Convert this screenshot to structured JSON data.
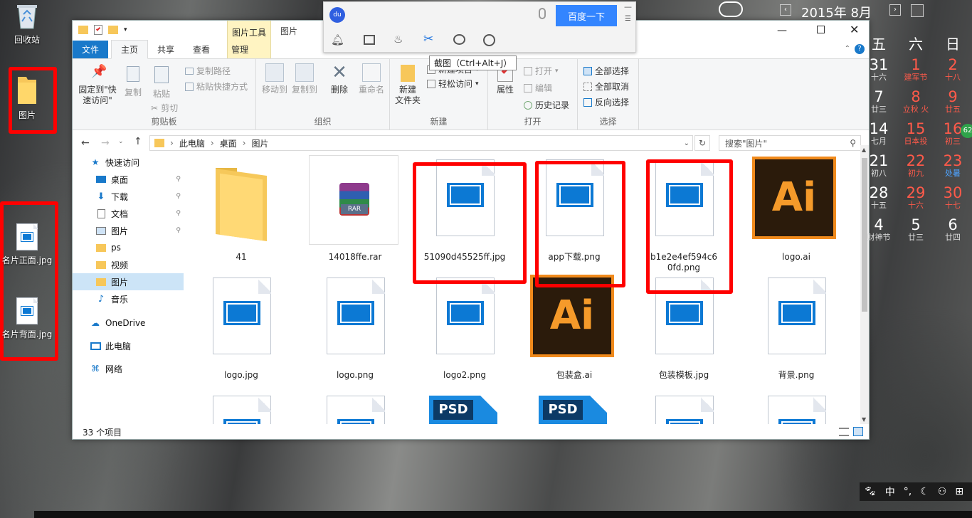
{
  "desktop": {
    "icons": [
      {
        "label": "回收站"
      },
      {
        "label": "图片"
      },
      {
        "label": "名片正面.jpg"
      },
      {
        "label": "名片背面.jpg"
      }
    ]
  },
  "baidu": {
    "search_value": "",
    "button_label": "百度一下",
    "tooltip": "截图（Ctrl+Alt+J）"
  },
  "explorer": {
    "title_context_tab": "图片工具",
    "title_name": "图片",
    "tabs": [
      "文件",
      "主页",
      "共享",
      "查看",
      "管理"
    ],
    "ribbon": {
      "clipboard": {
        "name": "剪贴板",
        "pin": "固定到\"快速访问\"",
        "copy": "复制",
        "paste": "粘贴",
        "copy_path": "复制路径",
        "paste_shortcut": "粘贴快捷方式",
        "cut": "剪切"
      },
      "organize": {
        "name": "组织",
        "move_to": "移动到",
        "copy_to": "复制到",
        "delete": "删除",
        "rename": "重命名"
      },
      "new": {
        "name": "新建",
        "new_folder": "新建\n文件夹",
        "new_item": "新建项目",
        "easy_access": "轻松访问"
      },
      "open": {
        "name": "打开",
        "properties": "属性",
        "open": "打开",
        "edit": "编辑",
        "history": "历史记录"
      },
      "select": {
        "name": "选择",
        "select_all": "全部选择",
        "select_none": "全部取消",
        "invert": "反向选择"
      }
    },
    "address": {
      "crumbs": [
        "此电脑",
        "桌面",
        "图片"
      ],
      "search_placeholder": "搜索\"图片\""
    },
    "nav": [
      {
        "label": "快速访问",
        "icon": "star-icon"
      },
      {
        "label": "桌面",
        "icon": "desktop-icon",
        "pinned": true
      },
      {
        "label": "下载",
        "icon": "download-icon",
        "pinned": true
      },
      {
        "label": "文档",
        "icon": "document-icon",
        "pinned": true
      },
      {
        "label": "图片",
        "icon": "picture-icon",
        "pinned": true
      },
      {
        "label": "ps",
        "icon": "folder-icon"
      },
      {
        "label": "视频",
        "icon": "folder-icon"
      },
      {
        "label": "图片",
        "icon": "folder-icon",
        "selected": true
      },
      {
        "label": "音乐",
        "icon": "music-icon"
      },
      {
        "label": "OneDrive",
        "icon": "cloud-icon"
      },
      {
        "label": "此电脑",
        "icon": "computer-icon"
      },
      {
        "label": "网络",
        "icon": "network-icon"
      }
    ],
    "files": [
      {
        "name": "41",
        "type": "folder"
      },
      {
        "name": "14018ffe.rar",
        "type": "rar"
      },
      {
        "name": "51090d45525ff.jpg",
        "type": "image",
        "marked": true
      },
      {
        "name": "app下载.png",
        "type": "image",
        "marked": true
      },
      {
        "name": "b1e2e4ef594c60fd.png",
        "type": "image",
        "marked": true
      },
      {
        "name": "logo.ai",
        "type": "ai"
      },
      {
        "name": "logo.jpg",
        "type": "image"
      },
      {
        "name": "logo.png",
        "type": "image"
      },
      {
        "name": "logo2.png",
        "type": "image"
      },
      {
        "name": "包装盒.ai",
        "type": "ai"
      },
      {
        "name": "包装模板.jpg",
        "type": "image"
      },
      {
        "name": "背景.png",
        "type": "image"
      },
      {
        "name": "",
        "type": "image"
      },
      {
        "name": "",
        "type": "image"
      },
      {
        "name": "",
        "type": "psd"
      },
      {
        "name": "",
        "type": "psd"
      },
      {
        "name": "",
        "type": "image"
      },
      {
        "name": "",
        "type": "image"
      }
    ],
    "status": "33 个项目"
  },
  "calendar": {
    "year_month": "2015年 8月",
    "weekdays": [
      "五",
      "六",
      "日"
    ],
    "rows": [
      [
        {
          "n": "31",
          "s": "十六"
        },
        {
          "n": "1",
          "s": "建军节",
          "c": "red"
        },
        {
          "n": "2",
          "s": "十八",
          "c": "red"
        }
      ],
      [
        {
          "n": "7",
          "s": "廿三"
        },
        {
          "n": "8",
          "s": "立秋 火",
          "c": "red"
        },
        {
          "n": "9",
          "s": "廿五",
          "c": "red"
        }
      ],
      [
        {
          "n": "14",
          "s": "七月"
        },
        {
          "n": "15",
          "s": "日本投",
          "c": "red"
        },
        {
          "n": "16",
          "s": "初三",
          "c": "red"
        }
      ],
      [
        {
          "n": "21",
          "s": "初八"
        },
        {
          "n": "22",
          "s": "初九",
          "c": "red"
        },
        {
          "n": "23",
          "s": "处暑",
          "c": "red"
        }
      ],
      [
        {
          "n": "28",
          "s": "十五"
        },
        {
          "n": "29",
          "s": "十六",
          "c": "red"
        },
        {
          "n": "30",
          "s": "十七",
          "c": "red"
        }
      ],
      [
        {
          "n": "4",
          "s": "财神节"
        },
        {
          "n": "5",
          "s": "廿三"
        },
        {
          "n": "6",
          "s": "廿四"
        }
      ]
    ],
    "badge": "62"
  },
  "ime": {
    "lang": "中"
  }
}
